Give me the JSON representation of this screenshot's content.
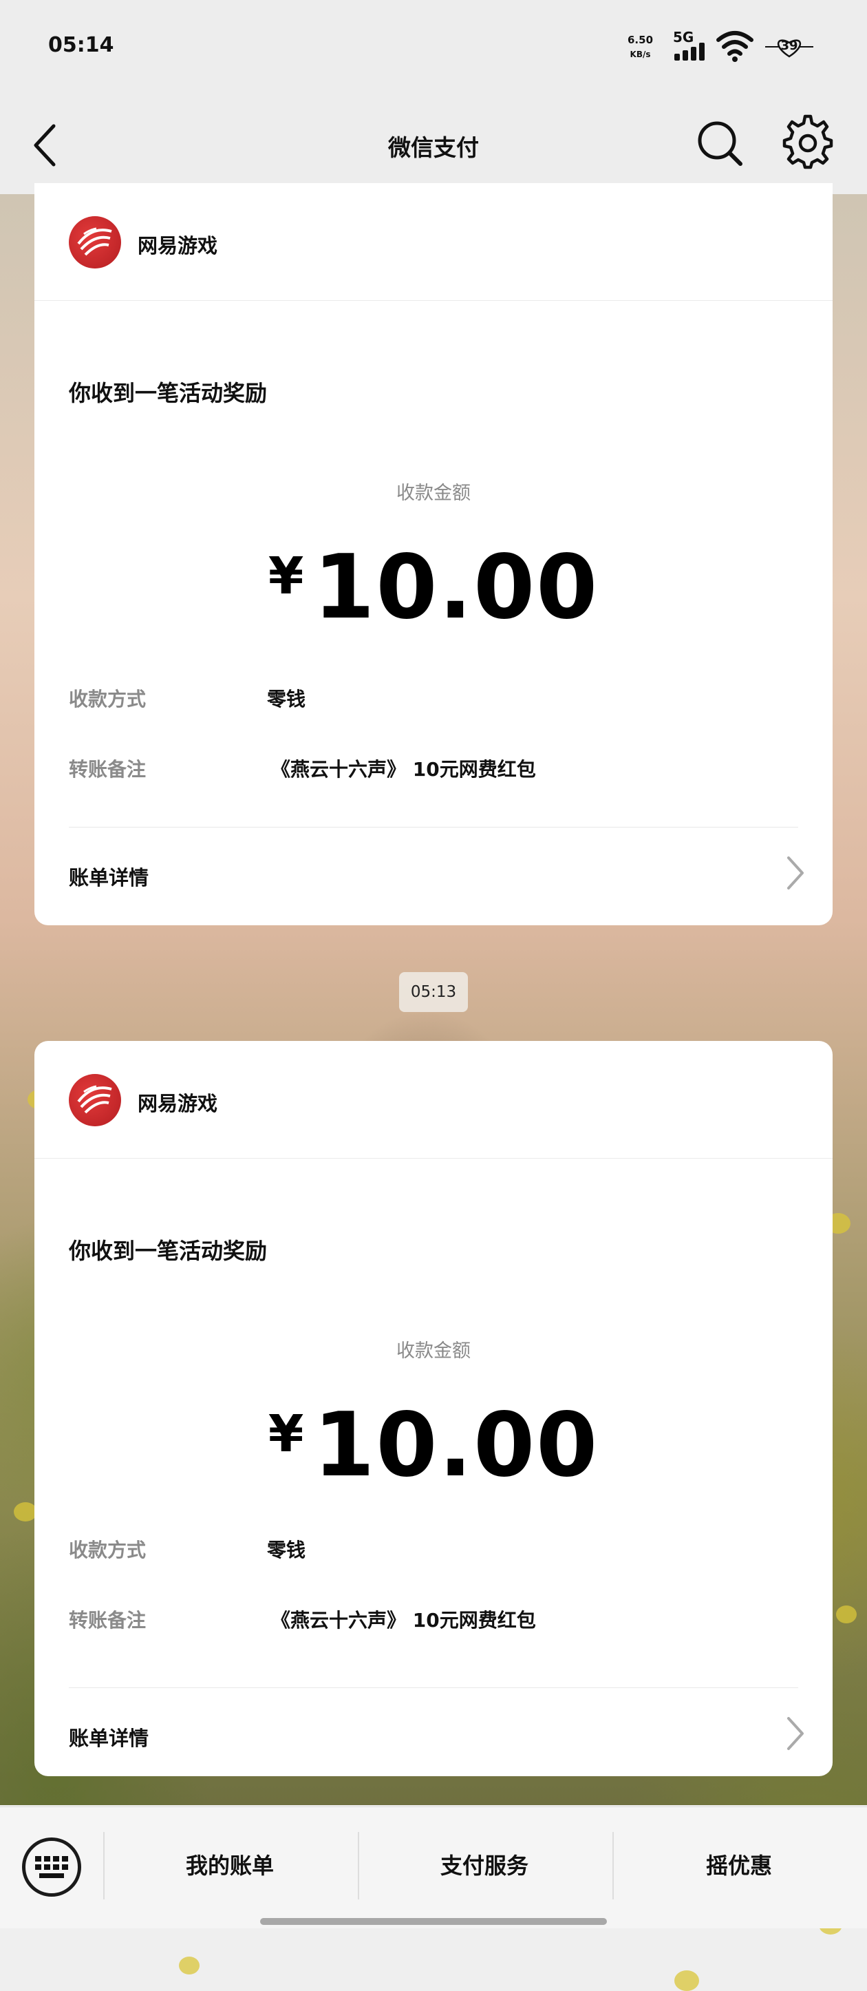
{
  "status_bar": {
    "time": "05:14",
    "net_speed_value": "6.50",
    "net_speed_unit": "KB/s",
    "signal_label": "5G",
    "battery_level": "39"
  },
  "nav": {
    "title": "微信支付",
    "icons": [
      "back-arrow-icon",
      "search-icon",
      "gear-icon"
    ]
  },
  "messages": [
    {
      "merchant": "网易游戏",
      "title": "你收到一笔活动奖励",
      "amount_label": "收款金额",
      "currency_symbol": "¥",
      "amount": "10.00",
      "rows": [
        {
          "label": "收款方式",
          "value": "零钱"
        },
        {
          "label": "转账备注",
          "value": "《燕云十六声》 10元网费红包"
        }
      ],
      "detail_link": "账单详情"
    },
    {
      "merchant": "网易游戏",
      "title": "你收到一笔活动奖励",
      "amount_label": "收款金额",
      "currency_symbol": "¥",
      "amount": "10.00",
      "rows": [
        {
          "label": "收款方式",
          "value": "零钱"
        },
        {
          "label": "转账备注",
          "value": "《燕云十六声》 10元网费红包"
        }
      ],
      "detail_link": "账单详情"
    }
  ],
  "timestamp_between": "05:13",
  "bottom_bar": {
    "tabs": [
      "我的账单",
      "支付服务",
      "摇优惠"
    ],
    "keyboard_icon": "keyboard-icon"
  },
  "colors": {
    "logo_red": "#c8262b",
    "background": "#ededed",
    "card": "#ffffff"
  }
}
